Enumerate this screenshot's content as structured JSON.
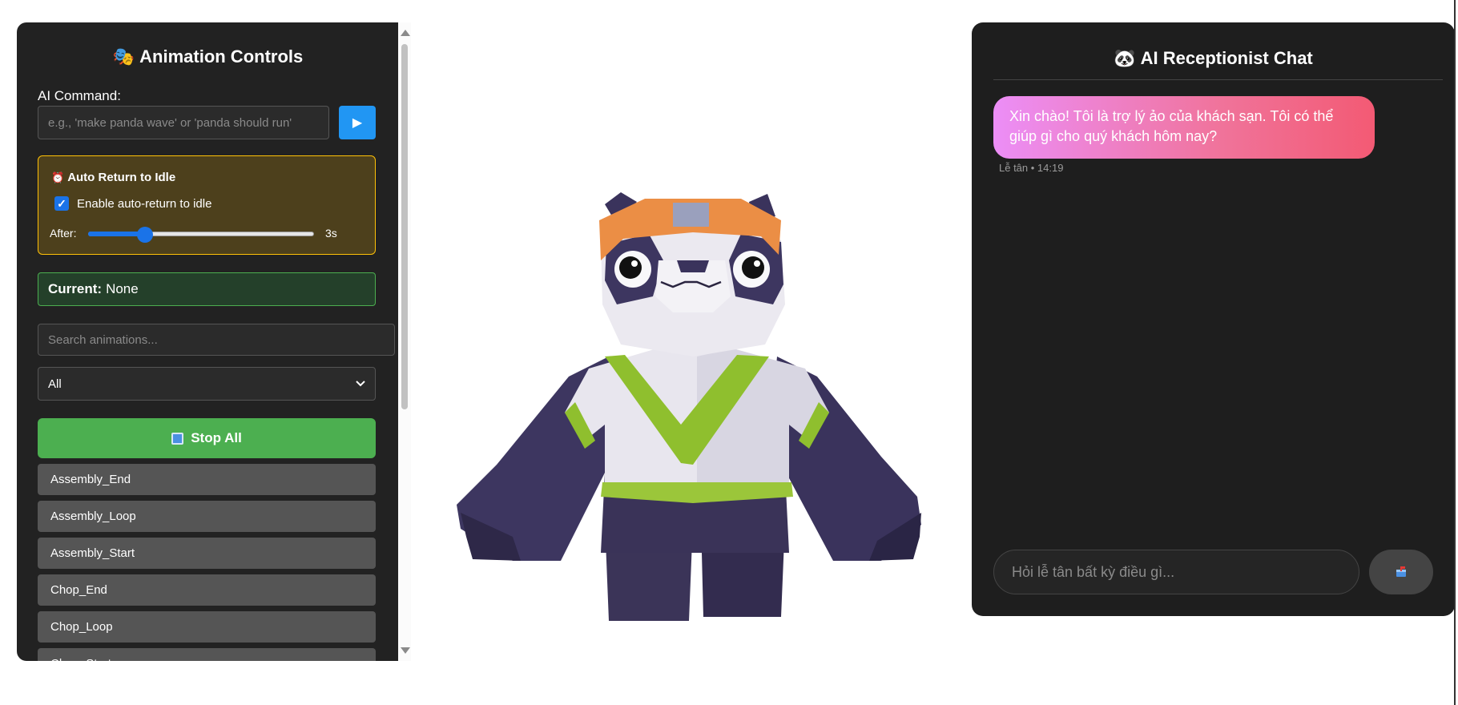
{
  "controls": {
    "title": "Animation Controls",
    "title_icon": "🎭",
    "ai_command_label": "AI Command:",
    "ai_command_placeholder": "e.g., 'make panda wave' or 'panda should run'",
    "ai_command_value": "",
    "run_button_icon": "play-icon",
    "run_button_glyph": "▶",
    "auto_idle": {
      "title_icon": "⏰",
      "title": "Auto Return to Idle",
      "checkbox_label": "Enable auto-return to idle",
      "checked": true,
      "after_label": "After:",
      "slider_fraction": 0.25,
      "value": "3s"
    },
    "current_label": "Current:",
    "current_value": "None",
    "search_placeholder": "Search animations...",
    "category_value": "All",
    "stop_all_label": "Stop All",
    "animations": [
      "Assembly_End",
      "Assembly_Loop",
      "Assembly_Start",
      "Chop_End",
      "Chop_Loop",
      "Chop_Start"
    ]
  },
  "chat": {
    "title_icon": "🐼",
    "title": "AI Receptionist Chat",
    "messages": [
      {
        "text": "Xin chào! Tôi là trợ lý ảo của khách sạn. Tôi có thể giúp gì cho quý khách hôm nay?",
        "meta": "Lễ tân • 14:19"
      }
    ],
    "input_placeholder": "Hỏi lễ tân bất kỳ điều gì...",
    "send_icon": "mailbox-icon"
  },
  "colors": {
    "panel_bg": "#222222",
    "accent_blue": "#2196f3",
    "idle_border": "#ffc107",
    "current_border": "#4caf50",
    "stop_green": "#4caf50",
    "bubble_gradient_start": "#ec8ef7",
    "bubble_gradient_end": "#f35a74"
  }
}
